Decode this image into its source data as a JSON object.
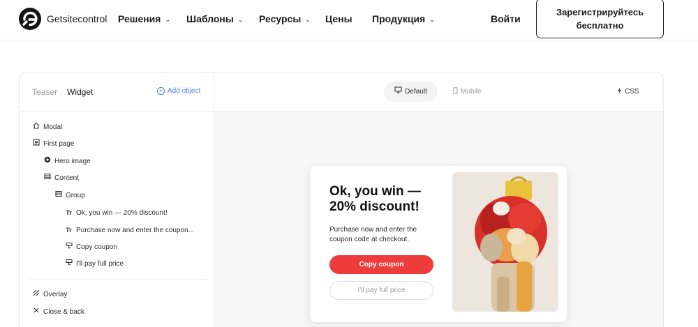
{
  "nav": {
    "brand": "Getsitecontrol",
    "items": [
      {
        "label": "Решения",
        "dropdown": true
      },
      {
        "label": "Шаблоны",
        "dropdown": true
      },
      {
        "label": "Ресурсы",
        "dropdown": true
      },
      {
        "label": "Цены",
        "dropdown": false
      },
      {
        "label": "Продукция",
        "dropdown": true
      }
    ],
    "login": "Войти",
    "signup_line1": "Зарегистрируйтесь",
    "signup_line2": "бесплатно"
  },
  "sidebar": {
    "tabs": [
      "Teaser",
      "Widget"
    ],
    "active_tab": "Widget",
    "add_object": "Add object",
    "tree": [
      {
        "label": "Modal",
        "icon": "home-icon"
      },
      {
        "label": "First page",
        "icon": "page-icon"
      },
      {
        "label": "Hero image",
        "icon": "image-icon"
      },
      {
        "label": "Content",
        "icon": "layout-icon"
      },
      {
        "label": "Group",
        "icon": "group-icon"
      },
      {
        "label": "Ok, you win — 20% discount!",
        "icon": "text-icon"
      },
      {
        "label": "Purchase now and enter the coupon...",
        "icon": "text-icon"
      },
      {
        "label": "Copy coupon",
        "icon": "button-icon"
      },
      {
        "label": "I'll pay full price",
        "icon": "button-icon"
      },
      {
        "label": "Overlay",
        "icon": "overlay-icon"
      },
      {
        "label": "Close & back",
        "icon": "close-icon"
      }
    ]
  },
  "preview": {
    "modes": [
      "Default",
      "Mobile"
    ],
    "active_mode": "Default",
    "css": "CSS"
  },
  "popup": {
    "title": "Ok, you win — 20% discount!",
    "body": "Purchase now and enter the coupon code at checkout.",
    "primary_button": "Copy coupon",
    "secondary_button": "I'll pay full price"
  },
  "colors": {
    "accent_red": "#ee3b3b",
    "link_blue": "#4a7fd6",
    "text_dark": "#1b1b1b"
  }
}
